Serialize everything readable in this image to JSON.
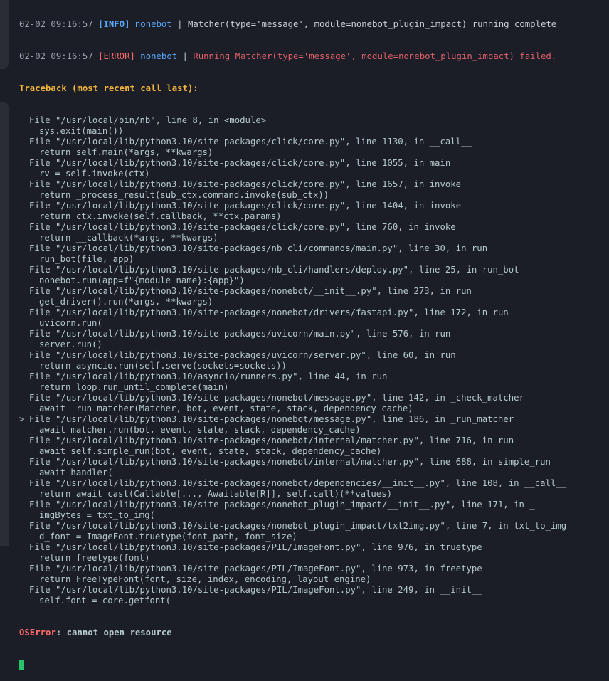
{
  "log": [
    {
      "time": "02-02 09:16:57",
      "level": "[INFO]",
      "logger": "nonebot",
      "message": "Matcher(type='message', module=nonebot_plugin_impact) running complete"
    },
    {
      "time": "02-02 09:16:57",
      "level": "[ERROR]",
      "logger": "nonebot",
      "message": "Running Matcher(type='message', module=nonebot_plugin_impact) failed."
    }
  ],
  "separator": "|",
  "traceback_header": "Traceback (most recent call last):",
  "frames": [
    {
      "file": "File \"/usr/local/bin/nb\", line 8, in <module>",
      "code": "sys.exit(main())",
      "marker": ""
    },
    {
      "file": "File \"/usr/local/lib/python3.10/site-packages/click/core.py\", line 1130, in __call__",
      "code": "return self.main(*args, **kwargs)",
      "marker": ""
    },
    {
      "file": "File \"/usr/local/lib/python3.10/site-packages/click/core.py\", line 1055, in main",
      "code": "rv = self.invoke(ctx)",
      "marker": ""
    },
    {
      "file": "File \"/usr/local/lib/python3.10/site-packages/click/core.py\", line 1657, in invoke",
      "code": "return _process_result(sub_ctx.command.invoke(sub_ctx))",
      "marker": ""
    },
    {
      "file": "File \"/usr/local/lib/python3.10/site-packages/click/core.py\", line 1404, in invoke",
      "code": "return ctx.invoke(self.callback, **ctx.params)",
      "marker": ""
    },
    {
      "file": "File \"/usr/local/lib/python3.10/site-packages/click/core.py\", line 760, in invoke",
      "code": "return __callback(*args, **kwargs)",
      "marker": ""
    },
    {
      "file": "File \"/usr/local/lib/python3.10/site-packages/nb_cli/commands/main.py\", line 30, in run",
      "code": "run_bot(file, app)",
      "marker": ""
    },
    {
      "file": "File \"/usr/local/lib/python3.10/site-packages/nb_cli/handlers/deploy.py\", line 25, in run_bot",
      "code": "nonebot.run(app=f\"{module_name}:{app}\")",
      "marker": ""
    },
    {
      "file": "File \"/usr/local/lib/python3.10/site-packages/nonebot/__init__.py\", line 273, in run",
      "code": "get_driver().run(*args, **kwargs)",
      "marker": ""
    },
    {
      "file": "File \"/usr/local/lib/python3.10/site-packages/nonebot/drivers/fastapi.py\", line 172, in run",
      "code": "uvicorn.run(",
      "marker": ""
    },
    {
      "file": "File \"/usr/local/lib/python3.10/site-packages/uvicorn/main.py\", line 576, in run",
      "code": "server.run()",
      "marker": ""
    },
    {
      "file": "File \"/usr/local/lib/python3.10/site-packages/uvicorn/server.py\", line 60, in run",
      "code": "return asyncio.run(self.serve(sockets=sockets))",
      "marker": ""
    },
    {
      "file": "File \"/usr/local/lib/python3.10/asyncio/runners.py\", line 44, in run",
      "code": "return loop.run_until_complete(main)",
      "marker": ""
    },
    {
      "file": "File \"/usr/local/lib/python3.10/site-packages/nonebot/message.py\", line 142, in _check_matcher",
      "code": "await _run_matcher(Matcher, bot, event, state, stack, dependency_cache)",
      "marker": ""
    },
    {
      "file": "File \"/usr/local/lib/python3.10/site-packages/nonebot/message.py\", line 186, in _run_matcher",
      "code": "await matcher.run(bot, event, state, stack, dependency_cache)",
      "marker": ">"
    },
    {
      "file": "File \"/usr/local/lib/python3.10/site-packages/nonebot/internal/matcher.py\", line 716, in run",
      "code": "await self.simple_run(bot, event, state, stack, dependency_cache)",
      "marker": ""
    },
    {
      "file": "File \"/usr/local/lib/python3.10/site-packages/nonebot/internal/matcher.py\", line 688, in simple_run",
      "code": "await handler(",
      "marker": ""
    },
    {
      "file": "File \"/usr/local/lib/python3.10/site-packages/nonebot/dependencies/__init__.py\", line 108, in __call__",
      "code": "return await cast(Callable[..., Awaitable[R]], self.call)(**values)",
      "marker": ""
    },
    {
      "file": "File \"/usr/local/lib/python3.10/site-packages/nonebot_plugin_impact/__init__.py\", line 171, in _",
      "code": "imgBytes = txt_to_img(",
      "marker": ""
    },
    {
      "file": "File \"/usr/local/lib/python3.10/site-packages/nonebot_plugin_impact/txt2img.py\", line 7, in txt_to_img",
      "code": "d_font = ImageFont.truetype(font_path, font_size)",
      "marker": ""
    },
    {
      "file": "File \"/usr/local/lib/python3.10/site-packages/PIL/ImageFont.py\", line 976, in truetype",
      "code": "return freetype(font)",
      "marker": ""
    },
    {
      "file": "File \"/usr/local/lib/python3.10/site-packages/PIL/ImageFont.py\", line 973, in freetype",
      "code": "return FreeTypeFont(font, size, index, encoding, layout_engine)",
      "marker": ""
    },
    {
      "file": "File \"/usr/local/lib/python3.10/site-packages/PIL/ImageFont.py\", line 249, in __init__",
      "code": "self.font = core.getfont(",
      "marker": ""
    }
  ],
  "exception": {
    "name": "OSError",
    "message": ": cannot open resource"
  },
  "colors": {
    "background": "#1b1e26",
    "info": "#5aa9ff",
    "error": "#ff6b6b",
    "traceback_header": "#f2b43c",
    "cursor": "#27c26c"
  }
}
